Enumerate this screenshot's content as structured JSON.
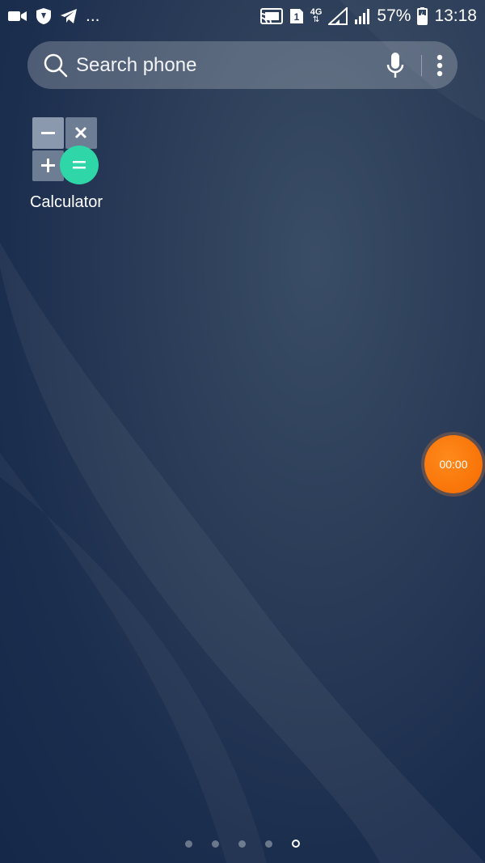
{
  "status_bar": {
    "left_icons": [
      "video-camera-icon",
      "shield-icon",
      "telegram-icon"
    ],
    "overflow": "...",
    "right_icons": [
      "cast-icon",
      "sim-1-icon",
      "4g-data-icon",
      "signal-icon",
      "signal-icon"
    ],
    "network_type": "4G",
    "sim_label": "1",
    "battery": "57%",
    "time": "13:18"
  },
  "search": {
    "placeholder": "Search phone"
  },
  "apps": [
    {
      "label": "Calculator",
      "icon": "calculator-icon"
    }
  ],
  "recorder": {
    "time": "00:00"
  },
  "pages": {
    "count": 5,
    "active": 5
  },
  "colors": {
    "calculator_accent": "#2ed6a8",
    "recorder": "#f77a0a"
  }
}
